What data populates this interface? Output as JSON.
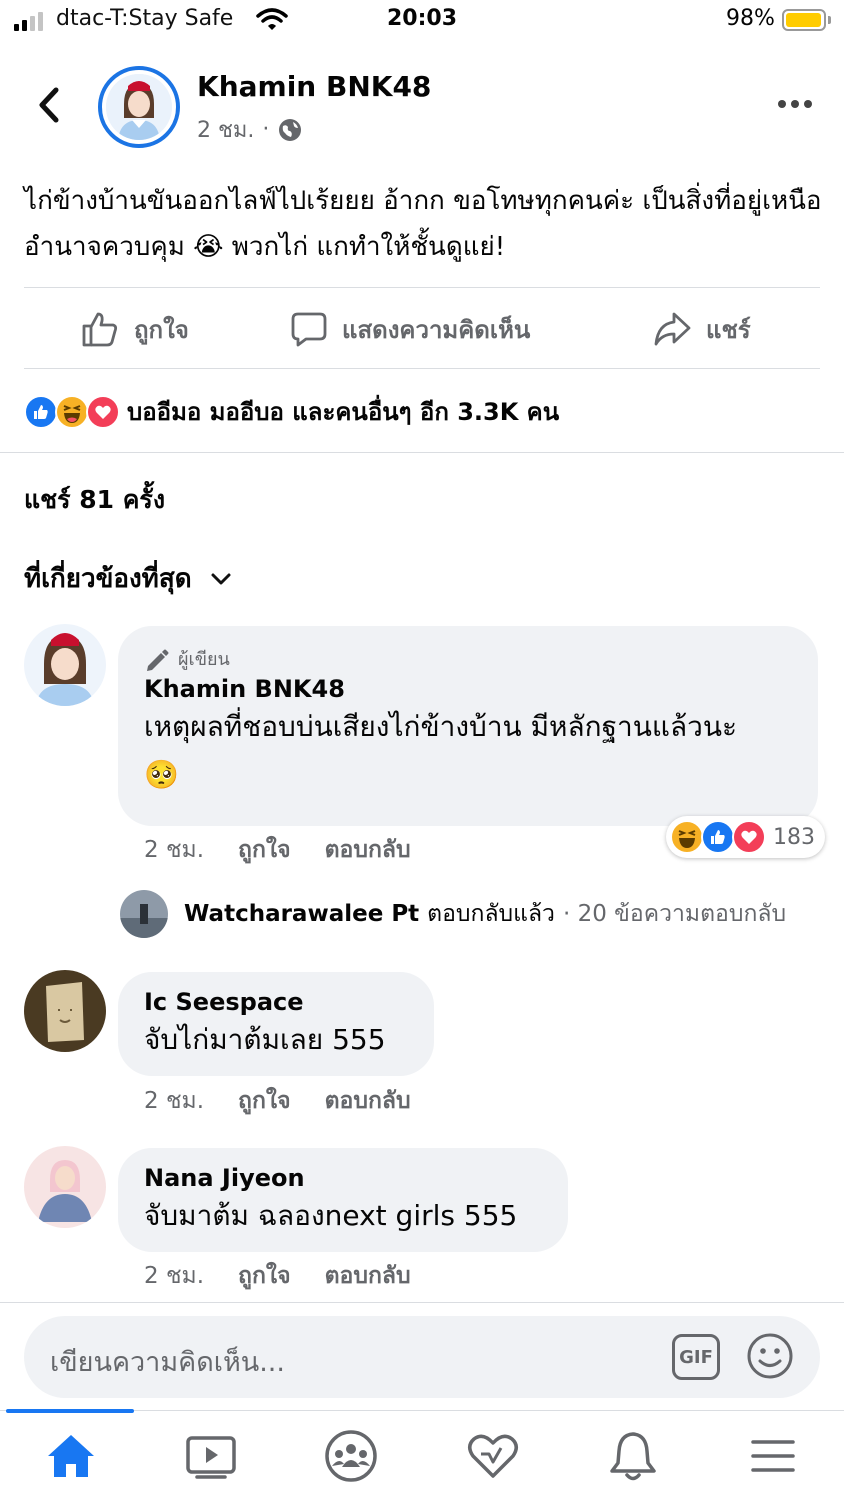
{
  "status_bar": {
    "carrier": "dtac-T:Stay Safe",
    "time": "20:03",
    "battery": "98%",
    "battery_level": 0.98
  },
  "post": {
    "author": "Khamin BNK48",
    "time": "2 ชม.",
    "privacy_icon": "globe-icon",
    "text": "ไก่ข้างบ้านขันออกไลฟ์ไปเร้ยยย อ้ากก ขอโทษทุกคนค่ะ เป็นสิ่งที่อยู่เหนืออำนาจควบคุม 😭 พวกไก่ แกทำให้ชั้นดูแย่!"
  },
  "actions": {
    "like": "ถูกใจ",
    "comment": "แสดงความคิดเห็น",
    "share": "แชร์"
  },
  "reactions": {
    "summary": "บออีมอ มออีบอ และคนอื่นๆ อีก 3.3K คน",
    "types": [
      "like",
      "haha",
      "love"
    ]
  },
  "shares": "แชร์ 81 ครั้ง",
  "sort_label": "ที่เกี่ยวข้องที่สุด",
  "comments": [
    {
      "badge": "ผู้เขียน",
      "name": "Khamin BNK48",
      "text": "เหตุผลที่ชอบบ่นเสียงไก่ข้างบ้าน มีหลักฐานแล้วนะ",
      "emoji": "🥺",
      "time": "2 ชม.",
      "like": "ถูกใจ",
      "reply": "ตอบกลับ",
      "reaction_count": "183",
      "reply_summary": {
        "name": "Watcharawalee Pt",
        "action": "ตอบกลับแล้ว",
        "count": "· 20 ข้อความตอบกลับ"
      }
    },
    {
      "name": "Ic Seespace",
      "text": "จับไก่มาต้มเลย 555",
      "time": "2 ชม.",
      "like": "ถูกใจ",
      "reply": "ตอบกลับ"
    },
    {
      "name": "Nana Jiyeon",
      "text": "จับมาต้ม ฉลองnext girls 555",
      "time": "2 ชม.",
      "like": "ถูกใจ",
      "reply": "ตอบกลับ"
    }
  ],
  "composer": {
    "placeholder": "เขียนความคิดเห็น...",
    "gif": "GIF"
  },
  "tabs": [
    "home-icon",
    "watch-icon",
    "groups-icon",
    "dating-icon",
    "notifications-icon",
    "menu-icon"
  ],
  "colors": {
    "accent": "#1877f2",
    "bubble": "#f0f2f5",
    "muted": "#65676b"
  }
}
